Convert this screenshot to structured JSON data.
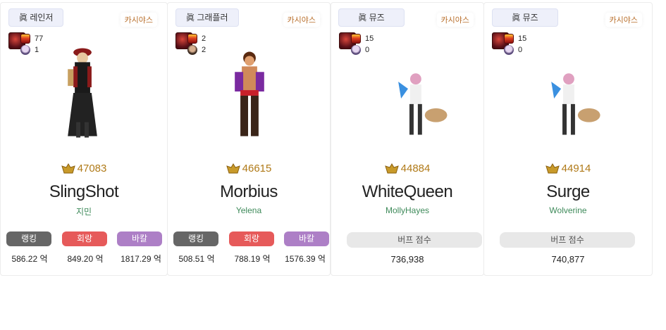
{
  "cards": [
    {
      "job": "眞 레인저",
      "server": "카시야스",
      "stat1": "77",
      "stat2": "1",
      "fame": "47083",
      "name": "SlingShot",
      "adventure": "지민",
      "labels": {
        "rank": "랭킹",
        "ret": "회랑",
        "bak": "바칼"
      },
      "values": {
        "rank": "586.22 억",
        "ret": "849.20 억",
        "bak": "1817.29 억"
      }
    },
    {
      "job": "眞 그래플러",
      "server": "카시야스",
      "stat1": "2",
      "stat2": "2",
      "fame": "46615",
      "name": "Morbius",
      "adventure": "Yelena",
      "labels": {
        "rank": "랭킹",
        "ret": "회랑",
        "bak": "바칼"
      },
      "values": {
        "rank": "508.51 억",
        "ret": "788.19 억",
        "bak": "1576.39 억"
      }
    },
    {
      "job": "眞 뮤즈",
      "server": "카시야스",
      "stat1": "15",
      "stat2": "0",
      "fame": "44884",
      "name": "WhiteQueen",
      "adventure": "MollyHayes",
      "buff_label": "버프 점수",
      "buff_value": "736,938"
    },
    {
      "job": "眞 뮤즈",
      "server": "카시야스",
      "stat1": "15",
      "stat2": "0",
      "fame": "44914",
      "name": "Surge",
      "adventure": "Wolverine",
      "buff_label": "버프 점수",
      "buff_value": "740,877"
    }
  ],
  "icons": [
    "cleared-dungeon-icon",
    "character-face-icon",
    "fame-trophy-icon"
  ],
  "colors": {
    "fame": "#b07a18",
    "adventure": "#3e8a5a",
    "server": "#b86e2a",
    "rank": "#666666",
    "ret": "#e65a5a",
    "bak": "#ad7fc6"
  }
}
